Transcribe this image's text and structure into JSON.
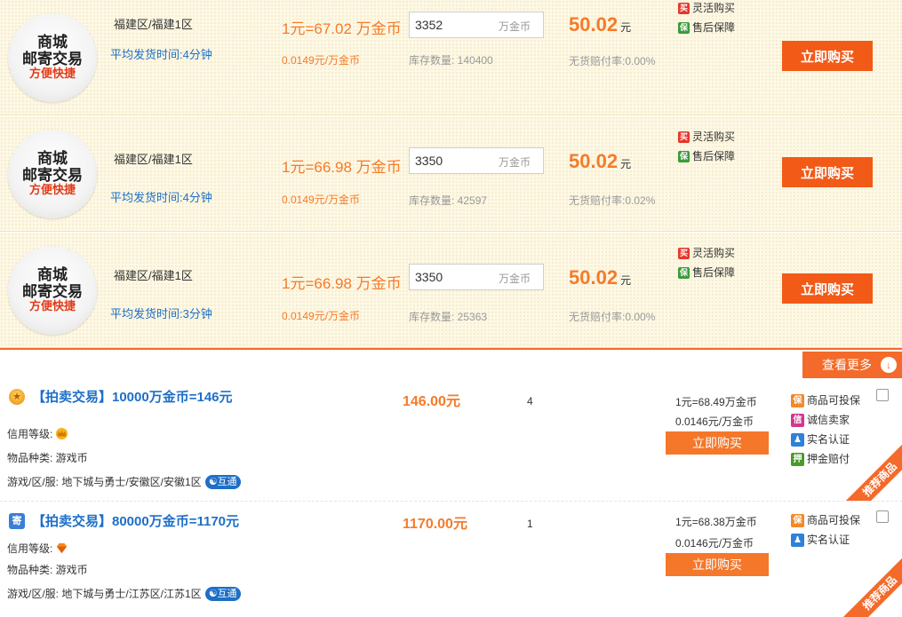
{
  "mall_rows": [
    {
      "seal": {
        "line1": "商城",
        "line2": "邮寄交易",
        "line3": "方便快捷"
      },
      "server": "福建区/福建1区",
      "delivery": "平均发货时间:4分钟",
      "rate": "1元=67.02 万金币",
      "unit_price": "0.0149元/万金币",
      "qty_value": "3352",
      "qty_unit": "万金币",
      "stock": "库存数量: 140400",
      "price": "50.02",
      "price_unit": "元",
      "no_delivery": "无货赔付率:0.00%",
      "tag1": "灵活购买",
      "tag2": "售后保障",
      "buy_label": "立即购买"
    },
    {
      "seal": {
        "line1": "商城",
        "line2": "邮寄交易",
        "line3": "方便快捷"
      },
      "server": "福建区/福建1区",
      "delivery": "平均发货时间:4分钟",
      "rate": "1元=66.98 万金币",
      "unit_price": "0.0149元/万金币",
      "qty_value": "3350",
      "qty_unit": "万金币",
      "stock": "库存数量: 42597",
      "price": "50.02",
      "price_unit": "元",
      "no_delivery": "无货赔付率:0.02%",
      "tag1": "灵活购买",
      "tag2": "售后保障",
      "buy_label": "立即购买"
    },
    {
      "seal": {
        "line1": "商城",
        "line2": "邮寄交易",
        "line3": "方便快捷"
      },
      "server": "福建区/福建1区",
      "delivery": "平均发货时间:3分钟",
      "rate": "1元=66.98 万金币",
      "unit_price": "0.0149元/万金币",
      "qty_value": "3350",
      "qty_unit": "万金币",
      "stock": "库存数量: 25363",
      "price": "50.02",
      "price_unit": "元",
      "no_delivery": "无货赔付率:0.00%",
      "tag1": "灵活购买",
      "tag2": "售后保障",
      "buy_label": "立即购买"
    }
  ],
  "more_label": "查看更多",
  "listings": [
    {
      "badge_icon": "medal-icon",
      "title": "【拍卖交易】10000万金币=146元",
      "credit_label": "信用等级:",
      "credit_icon": "crown-icon",
      "type_line": "物品种类: 游戏币",
      "server_line": "游戏/区/服: 地下城与勇士/安徽区/安徽1区",
      "hutong": "互通",
      "price": "146.00元",
      "count": "4",
      "rate": "1元=68.49万金币",
      "unit_price": "0.0146元/万金币",
      "buy_label": "立即购买",
      "tags": [
        "商品可投保",
        "诚信卖家",
        "实名认证",
        "押金赔付"
      ],
      "ribbon": "推荐商品"
    },
    {
      "badge_icon": "mail-icon",
      "title": "【拍卖交易】80000万金币=1170元",
      "credit_label": "信用等级:",
      "credit_icon": "diamond-icon",
      "type_line": "物品种类: 游戏币",
      "server_line": "游戏/区/服: 地下城与勇士/江苏区/江苏1区",
      "hutong": "互通",
      "price": "1170.00元",
      "count": "1",
      "rate": "1元=68.38万金币",
      "unit_price": "0.0146元/万金币",
      "buy_label": "立即购买",
      "tags": [
        "商品可投保",
        "实名认证"
      ],
      "ribbon": "推荐商品"
    }
  ],
  "colors": {
    "accent": "#f36a2a",
    "price": "#f57b2a",
    "link": "#1e6fc8",
    "row_bg": "#fdf8e6"
  }
}
